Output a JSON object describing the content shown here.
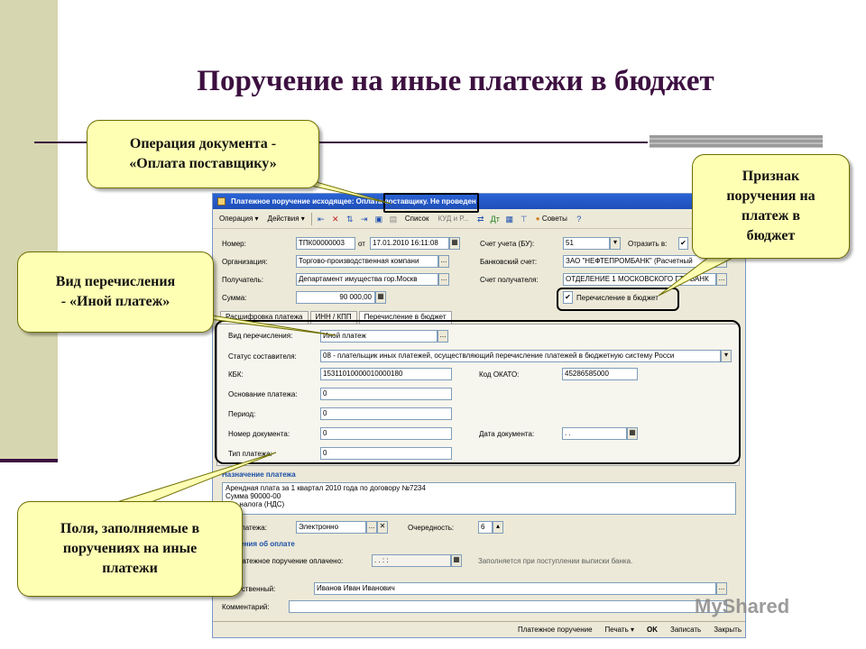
{
  "slide_title": "Поручение на иные платежи в бюджет",
  "callouts": {
    "operation": "Операция документа -\n«Оплата поставщику»",
    "budget_flag": "Признак\nпоручения на\nплатеж в\nбюджет",
    "transfer_type": "Вид перечисления\n- «Иной платеж»",
    "fields": "Поля, заполняемые в\nпоручениях на иные\nплатежи"
  },
  "window": {
    "title_prefix": "Платежное поручение исходящее: ",
    "title_operation": "Оплата поставщику",
    "title_suffix": ". Не проведен",
    "toolbar": {
      "operation": "Операция ▾",
      "actions": "Действия ▾",
      "list": "Список",
      "kud": "КУД и Р...",
      "tips": "Советы"
    },
    "header": {
      "number_label": "Номер:",
      "number": "ТПК00000003",
      "from_label": "от",
      "date": "17.01.2010 16:11:08",
      "org_label": "Организация:",
      "org": "Торгово-производственная компани",
      "recipient_label": "Получатель:",
      "recipient": "Департамент имущества гор.Москв",
      "sum_label": "Сумма:",
      "sum": "90 000,00",
      "account_bu_label": "Счет учета (БУ):",
      "account_bu": "51",
      "reflect_label": "Отразить в:",
      "bank_label": "Банковский счет:",
      "bank": "ЗАО \"НЕФТЕПРОМБАНК\" (Расчетный",
      "recipient_account_label": "Счет получателя:",
      "recipient_account": "ОТДЕЛЕНИЕ 1 МОСКОВСКОГО ГТУ БАНК",
      "budget_transfer_label": "Перечисление в бюджет"
    },
    "tabs": [
      "Расшифровка платежа",
      "ИНН / КПП",
      "Перечисление в бюджет"
    ],
    "budget": {
      "kind_label": "Вид перечисления:",
      "kind": "Иной платеж",
      "status_label": "Статус составителя:",
      "status": "08 - плательщик иных платежей, осуществляющий перечисление платежей в бюджетную систему Росси",
      "kbk_label": "КБК:",
      "kbk": "15311010000010000180",
      "okato_label": "Код ОКАТО:",
      "okato": "45286585000",
      "basis_label": "Основание платежа:",
      "basis": "0",
      "period_label": "Период:",
      "period": "0",
      "doc_number_label": "Номер документа:",
      "doc_number": "0",
      "doc_date_label": "Дата документа:",
      "doc_date": ". .",
      "pay_type_label": "Тип платежа:",
      "pay_type": "0"
    },
    "purpose_group": "Назначение платежа",
    "purpose_lines": [
      "Арендная плата за 1 квартал 2010 года по договору №7234",
      "Сумма 90000-00",
      "Без налога (НДС)"
    ],
    "payment_kind_label": "Вид платежа:",
    "payment_kind": "Электронно",
    "priority_label": "Очередность:",
    "priority": "6",
    "paid_group": "Сведения об оплате",
    "paid_label": "Платежное поручение оплачено:",
    "paid_value": ". .    : :",
    "paid_hint": "Заполняется при поступлении выписки банка.",
    "responsible_label": "Ответственный:",
    "responsible": "Иванов Иван Иванович",
    "comment_label": "Комментарий:",
    "comment": "",
    "status_buttons": [
      "Платежное поручение",
      "Печать ▾",
      "OK",
      "Записать",
      "Закрыть"
    ]
  },
  "watermark": "MyShared"
}
